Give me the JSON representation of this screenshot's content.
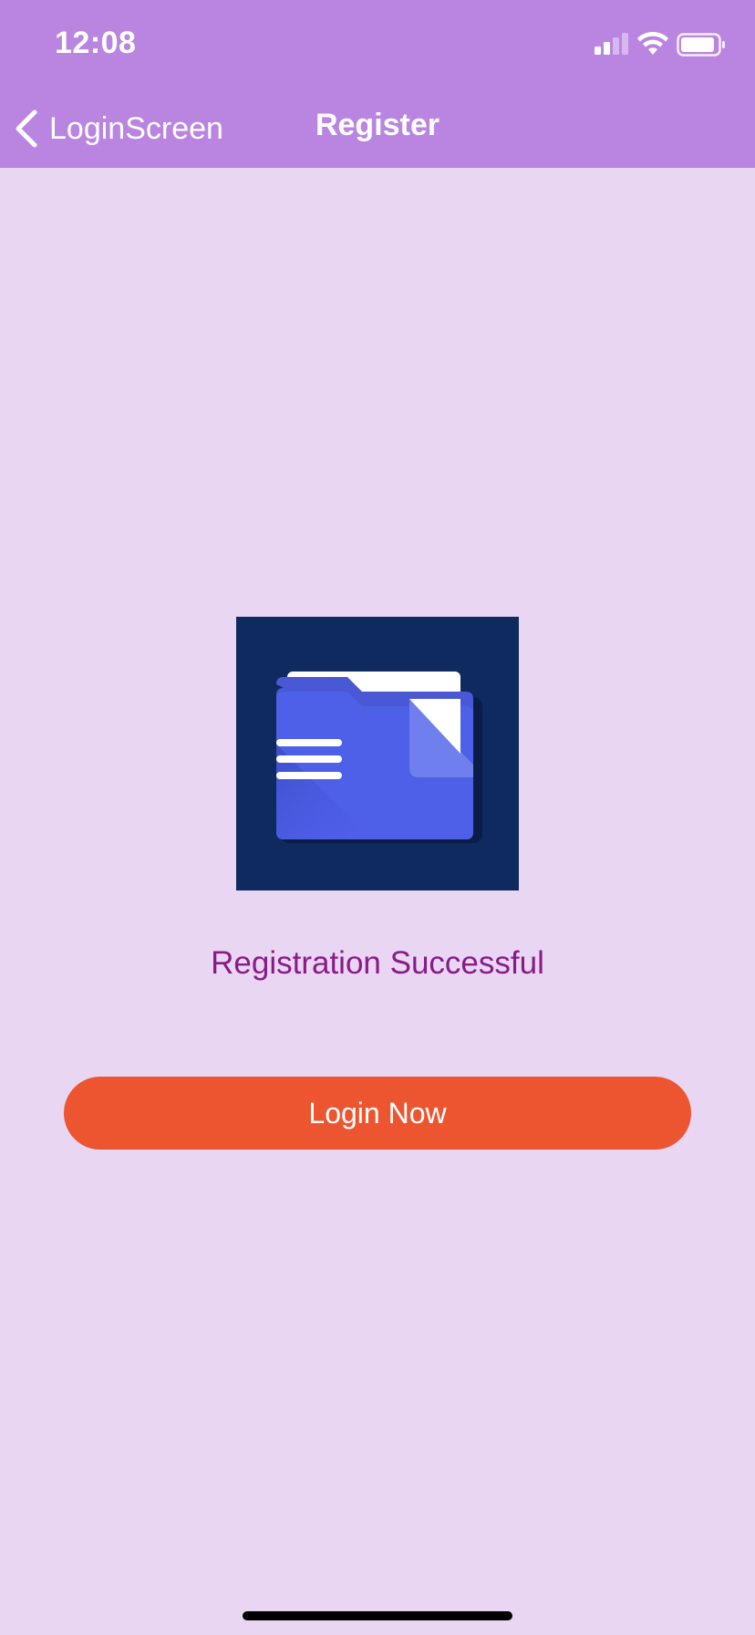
{
  "status_bar": {
    "time": "12:08"
  },
  "nav": {
    "back_label": "LoginScreen",
    "title": "Register"
  },
  "main": {
    "logo_icon": "folder-document-icon",
    "message": "Registration Successful",
    "login_button_label": "Login Now"
  },
  "colors": {
    "header": "#b985e0",
    "background": "#e8d6f3",
    "message_text": "#8a1a86",
    "button": "#ec552f",
    "logo_background": "#0f2a5e"
  }
}
